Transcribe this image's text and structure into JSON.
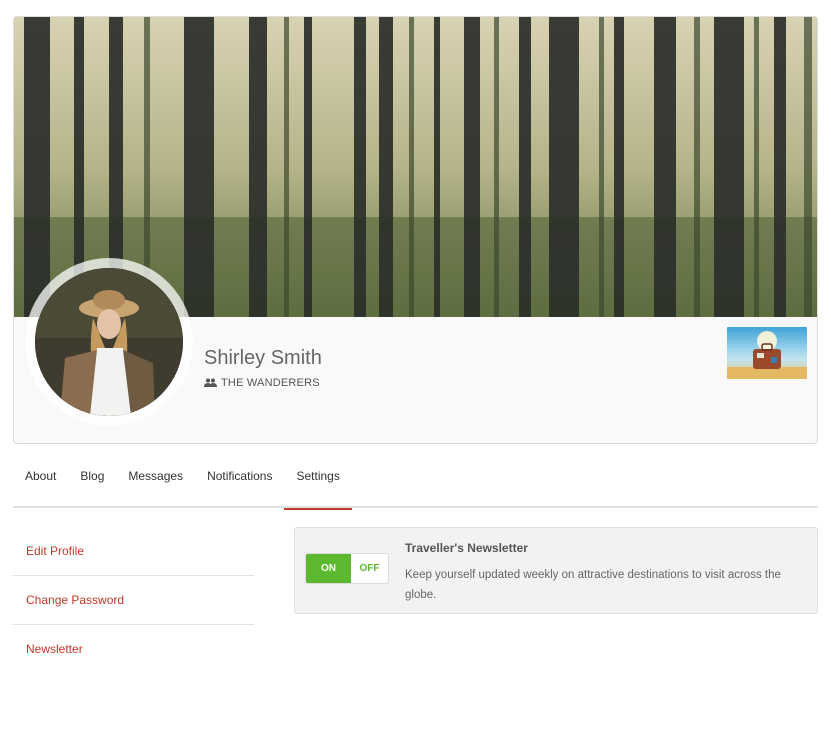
{
  "profile": {
    "name": "Shirley Smith",
    "group": "THE WANDERERS"
  },
  "tabs": [
    {
      "label": "About"
    },
    {
      "label": "Blog"
    },
    {
      "label": "Messages"
    },
    {
      "label": "Notifications"
    },
    {
      "label": "Settings",
      "active": true
    }
  ],
  "side_menu": [
    {
      "label": "Edit Profile"
    },
    {
      "label": "Change Password"
    },
    {
      "label": "Newsletter"
    }
  ],
  "newsletter": {
    "title": "Traveller's Newsletter",
    "description": "Keep yourself updated weekly on attractive destinations to visit across the globe.",
    "toggle_on": "ON",
    "toggle_off": "OFF",
    "state": "on"
  },
  "colors": {
    "accent": "#c0392b",
    "toggle_green": "#5cb82e"
  },
  "icons": {
    "group": "users-icon"
  }
}
